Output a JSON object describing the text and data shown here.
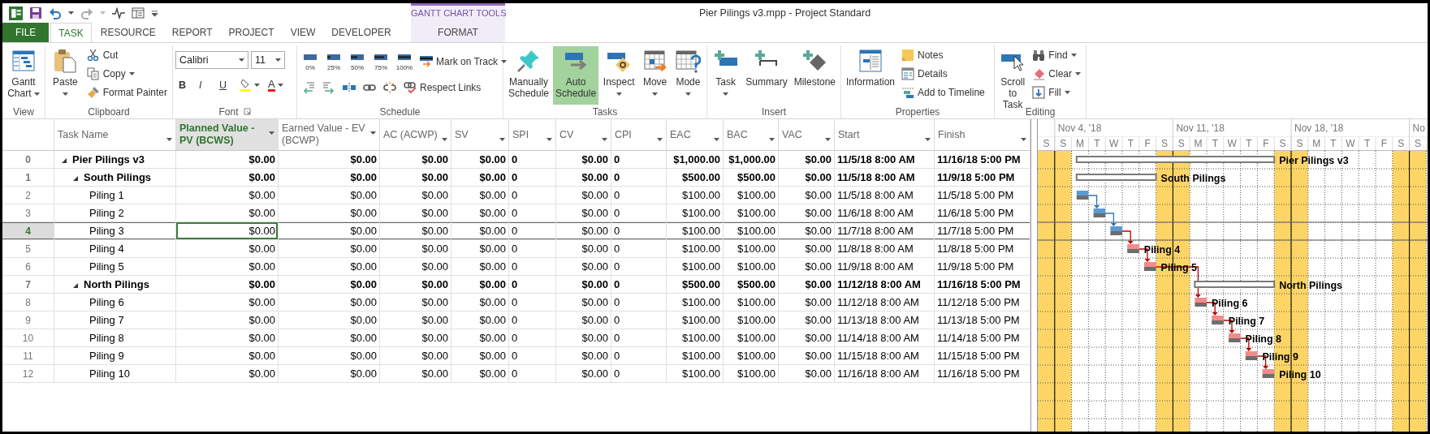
{
  "window": {
    "title": "Pier Pilings v3.mpp - Project Standard"
  },
  "contextual_tab_group": {
    "label": "GANTT CHART TOOLS"
  },
  "tabs": [
    {
      "label": "FILE",
      "kind": "file",
      "selected": false
    },
    {
      "label": "TASK",
      "kind": "tab",
      "selected": true
    },
    {
      "label": "RESOURCE",
      "kind": "tab",
      "selected": false
    },
    {
      "label": "REPORT",
      "kind": "tab",
      "selected": false
    },
    {
      "label": "PROJECT",
      "kind": "tab",
      "selected": false
    },
    {
      "label": "VIEW",
      "kind": "tab",
      "selected": false
    },
    {
      "label": "DEVELOPER",
      "kind": "tab",
      "selected": false
    },
    {
      "label": "FORMAT",
      "kind": "contextual",
      "selected": false
    }
  ],
  "ribbon": {
    "groups": [
      {
        "label": "View",
        "items": [
          {
            "kind": "large",
            "label": "Gantt Chart",
            "dropdown": true
          }
        ]
      },
      {
        "label": "Clipboard",
        "items": [
          {
            "kind": "large",
            "label": "Paste",
            "dropdown": true
          },
          {
            "kind": "small",
            "label": "Cut"
          },
          {
            "kind": "small",
            "label": "Copy",
            "dropdown": true
          },
          {
            "kind": "small",
            "label": "Format Painter"
          }
        ]
      },
      {
        "label": "Font",
        "dialog_launcher": true,
        "rows": [
          {
            "items": [
              {
                "kind": "field",
                "value": "Calibri"
              },
              {
                "kind": "field",
                "value": "11"
              }
            ]
          },
          {
            "items": [
              {
                "kind": "bold",
                "label": "B"
              },
              {
                "kind": "italic",
                "label": "I"
              },
              {
                "kind": "underline",
                "label": "U"
              },
              {
                "kind": "icon",
                "dropdown": true
              },
              {
                "kind": "fontcolor",
                "label": "A",
                "dropdown": true
              }
            ]
          }
        ]
      },
      {
        "label": "Schedule",
        "rows": [
          {
            "items": [
              {
                "kind": "percent",
                "label": "0%"
              },
              {
                "kind": "percent",
                "label": "25%"
              },
              {
                "kind": "percent",
                "label": "50%"
              },
              {
                "kind": "percent",
                "label": "75%"
              },
              {
                "kind": "percent",
                "label": "100%"
              },
              {
                "kind": "small",
                "label": "Mark on Track",
                "dropdown": true
              }
            ]
          },
          {
            "items": [
              {
                "kind": "icon"
              },
              {
                "kind": "icon"
              },
              {
                "kind": "icon"
              },
              {
                "kind": "icon"
              },
              {
                "kind": "icon"
              },
              {
                "kind": "small",
                "label": "Respect Links"
              }
            ]
          }
        ]
      },
      {
        "label": "Tasks",
        "items": [
          {
            "kind": "large",
            "label": "Manually Schedule",
            "selected": false
          },
          {
            "kind": "large",
            "label": "Auto Schedule",
            "selected": true
          },
          {
            "kind": "large",
            "label": "Inspect",
            "dropdown": true
          },
          {
            "kind": "large",
            "label": "Move",
            "dropdown": true
          },
          {
            "kind": "large",
            "label": "Mode",
            "dropdown": true
          }
        ]
      },
      {
        "label": "Insert",
        "items": [
          {
            "kind": "large",
            "label": "Task",
            "dropdown": true
          },
          {
            "kind": "large",
            "label": "Summary"
          },
          {
            "kind": "large",
            "label": "Milestone"
          }
        ]
      },
      {
        "label": "Properties",
        "items": [
          {
            "kind": "large",
            "label": "Information"
          },
          {
            "kind": "small",
            "label": "Notes"
          },
          {
            "kind": "small",
            "label": "Details"
          },
          {
            "kind": "small",
            "label": "Add to Timeline"
          }
        ]
      },
      {
        "label": "Editing",
        "items": [
          {
            "kind": "large",
            "label": "Scroll to Task"
          },
          {
            "kind": "small",
            "label": "Find",
            "dropdown": true
          },
          {
            "kind": "small",
            "label": "Clear",
            "dropdown": true
          },
          {
            "kind": "small",
            "label": "Fill",
            "dropdown": true
          }
        ]
      }
    ]
  },
  "table": {
    "columns": [
      {
        "label": "Task Name",
        "kind": "text",
        "selected": false
      },
      {
        "label": "Planned Value - PV (BCWS)",
        "kind": "money",
        "selected": true
      },
      {
        "label": "Earned Value - EV (BCWP)",
        "kind": "money",
        "selected": false
      },
      {
        "label": "AC (ACWP)",
        "kind": "money",
        "selected": false
      },
      {
        "label": "SV",
        "kind": "money",
        "selected": false
      },
      {
        "label": "SPI",
        "kind": "number",
        "selected": false
      },
      {
        "label": "CV",
        "kind": "money",
        "selected": false
      },
      {
        "label": "CPI",
        "kind": "number",
        "selected": false
      },
      {
        "label": "EAC",
        "kind": "money",
        "selected": false
      },
      {
        "label": "BAC",
        "kind": "money",
        "selected": false
      },
      {
        "label": "VAC",
        "kind": "money",
        "selected": false
      },
      {
        "label": "Start",
        "kind": "date",
        "selected": false
      },
      {
        "label": "Finish",
        "kind": "date",
        "selected": false
      }
    ],
    "rows": [
      {
        "id": "0",
        "name": "Pier Pilings v3",
        "expanded": true,
        "selected": false,
        "values": [
          "$0.00",
          "$0.00",
          "$0.00",
          "$0.00",
          "0",
          "$0.00",
          "0",
          "$1,000.00",
          "$1,000.00",
          "$0.00",
          "11/5/18 8:00 AM",
          "11/16/18 5:00 PM"
        ],
        "bar_label": "Pier Pilings v3",
        "children": [
          {
            "id": "1",
            "name": "South Pilings",
            "expanded": true,
            "selected": false,
            "values": [
              "$0.00",
              "$0.00",
              "$0.00",
              "$0.00",
              "0",
              "$0.00",
              "0",
              "$500.00",
              "$500.00",
              "$0.00",
              "11/5/18 8:00 AM",
              "11/9/18 5:00 PM"
            ],
            "bar_label": "South Pilings",
            "children": [
              {
                "id": "2",
                "name": "Piling 1",
                "selected": false,
                "critical": false,
                "values": [
                  "$0.00",
                  "$0.00",
                  "$0.00",
                  "$0.00",
                  "0",
                  "$0.00",
                  "0",
                  "$100.00",
                  "$100.00",
                  "$0.00",
                  "11/5/18 8:00 AM",
                  "11/5/18 5:00 PM"
                ]
              },
              {
                "id": "3",
                "name": "Piling 2",
                "selected": false,
                "critical": false,
                "linked": true,
                "values": [
                  "$0.00",
                  "$0.00",
                  "$0.00",
                  "$0.00",
                  "0",
                  "$0.00",
                  "0",
                  "$100.00",
                  "$100.00",
                  "$0.00",
                  "11/6/18 8:00 AM",
                  "11/6/18 5:00 PM"
                ]
              },
              {
                "id": "4",
                "name": "Piling 3",
                "selected": true,
                "critical": false,
                "linked": true,
                "values": [
                  "$0.00",
                  "$0.00",
                  "$0.00",
                  "$0.00",
                  "0",
                  "$0.00",
                  "0",
                  "$100.00",
                  "$100.00",
                  "$0.00",
                  "11/7/18 8:00 AM",
                  "11/7/18 5:00 PM"
                ]
              },
              {
                "id": "5",
                "name": "Piling 4",
                "selected": false,
                "critical": true,
                "linked": true,
                "values": [
                  "$0.00",
                  "$0.00",
                  "$0.00",
                  "$0.00",
                  "0",
                  "$0.00",
                  "0",
                  "$100.00",
                  "$100.00",
                  "$0.00",
                  "11/8/18 8:00 AM",
                  "11/8/18 5:00 PM"
                ],
                "bar_label": "Piling 4"
              },
              {
                "id": "6",
                "name": "Piling 5",
                "selected": false,
                "critical": true,
                "linked": true,
                "values": [
                  "$0.00",
                  "$0.00",
                  "$0.00",
                  "$0.00",
                  "0",
                  "$0.00",
                  "0",
                  "$100.00",
                  "$100.00",
                  "$0.00",
                  "11/9/18 8:00 AM",
                  "11/9/18 5:00 PM"
                ],
                "bar_label": "Piling 5"
              }
            ]
          },
          {
            "id": "7",
            "name": "North Pilings",
            "expanded": true,
            "selected": false,
            "values": [
              "$0.00",
              "$0.00",
              "$0.00",
              "$0.00",
              "0",
              "$0.00",
              "0",
              "$500.00",
              "$500.00",
              "$0.00",
              "11/12/18 8:00 AM",
              "11/16/18 5:00 PM"
            ],
            "bar_label": "North Pilings",
            "children": [
              {
                "id": "8",
                "name": "Piling 6",
                "selected": false,
                "critical": true,
                "linked": true,
                "values": [
                  "$0.00",
                  "$0.00",
                  "$0.00",
                  "$0.00",
                  "0",
                  "$0.00",
                  "0",
                  "$100.00",
                  "$100.00",
                  "$0.00",
                  "11/12/18 8:00 AM",
                  "11/12/18 5:00 PM"
                ],
                "bar_label": "Piling 6"
              },
              {
                "id": "9",
                "name": "Piling 7",
                "selected": false,
                "critical": true,
                "linked": true,
                "values": [
                  "$0.00",
                  "$0.00",
                  "$0.00",
                  "$0.00",
                  "0",
                  "$0.00",
                  "0",
                  "$100.00",
                  "$100.00",
                  "$0.00",
                  "11/13/18 8:00 AM",
                  "11/13/18 5:00 PM"
                ],
                "bar_label": "Piling 7"
              },
              {
                "id": "10",
                "name": "Piling 8",
                "selected": false,
                "critical": true,
                "linked": true,
                "values": [
                  "$0.00",
                  "$0.00",
                  "$0.00",
                  "$0.00",
                  "0",
                  "$0.00",
                  "0",
                  "$100.00",
                  "$100.00",
                  "$0.00",
                  "11/14/18 8:00 AM",
                  "11/14/18 5:00 PM"
                ],
                "bar_label": "Piling 8"
              },
              {
                "id": "11",
                "name": "Piling 9",
                "selected": false,
                "critical": true,
                "linked": true,
                "values": [
                  "$0.00",
                  "$0.00",
                  "$0.00",
                  "$0.00",
                  "0",
                  "$0.00",
                  "0",
                  "$100.00",
                  "$100.00",
                  "$0.00",
                  "11/15/18 8:00 AM",
                  "11/15/18 5:00 PM"
                ],
                "bar_label": "Piling 9"
              },
              {
                "id": "12",
                "name": "Piling 10",
                "selected": false,
                "critical": true,
                "linked": true,
                "values": [
                  "$0.00",
                  "$0.00",
                  "$0.00",
                  "$0.00",
                  "0",
                  "$0.00",
                  "0",
                  "$100.00",
                  "$100.00",
                  "$0.00",
                  "11/16/18 8:00 AM",
                  "11/16/18 5:00 PM"
                ],
                "bar_label": "Piling 10"
              }
            ]
          }
        ]
      }
    ]
  },
  "gantt": {
    "weeks": [
      "Nov 4, '18",
      "Nov 11, '18",
      "Nov 18, '18",
      "No"
    ],
    "days": [
      {
        "letter": "S",
        "nonworking": true
      },
      {
        "letter": "S",
        "nonworking": true
      },
      {
        "letter": "M",
        "nonworking": false
      },
      {
        "letter": "T",
        "nonworking": false
      },
      {
        "letter": "W",
        "nonworking": false
      },
      {
        "letter": "T",
        "nonworking": false
      },
      {
        "letter": "F",
        "nonworking": false
      },
      {
        "letter": "S",
        "nonworking": true
      },
      {
        "letter": "S",
        "nonworking": true
      },
      {
        "letter": "M",
        "nonworking": false
      },
      {
        "letter": "T",
        "nonworking": false
      },
      {
        "letter": "W",
        "nonworking": false
      },
      {
        "letter": "T",
        "nonworking": false
      },
      {
        "letter": "F",
        "nonworking": false
      },
      {
        "letter": "S",
        "nonworking": true
      },
      {
        "letter": "S",
        "nonworking": true
      },
      {
        "letter": "M",
        "nonworking": false
      },
      {
        "letter": "T",
        "nonworking": false
      },
      {
        "letter": "W",
        "nonworking": false
      },
      {
        "letter": "T",
        "nonworking": false
      },
      {
        "letter": "F",
        "nonworking": false
      },
      {
        "letter": "S",
        "nonworking": true
      },
      {
        "letter": "S",
        "nonworking": true
      }
    ]
  }
}
